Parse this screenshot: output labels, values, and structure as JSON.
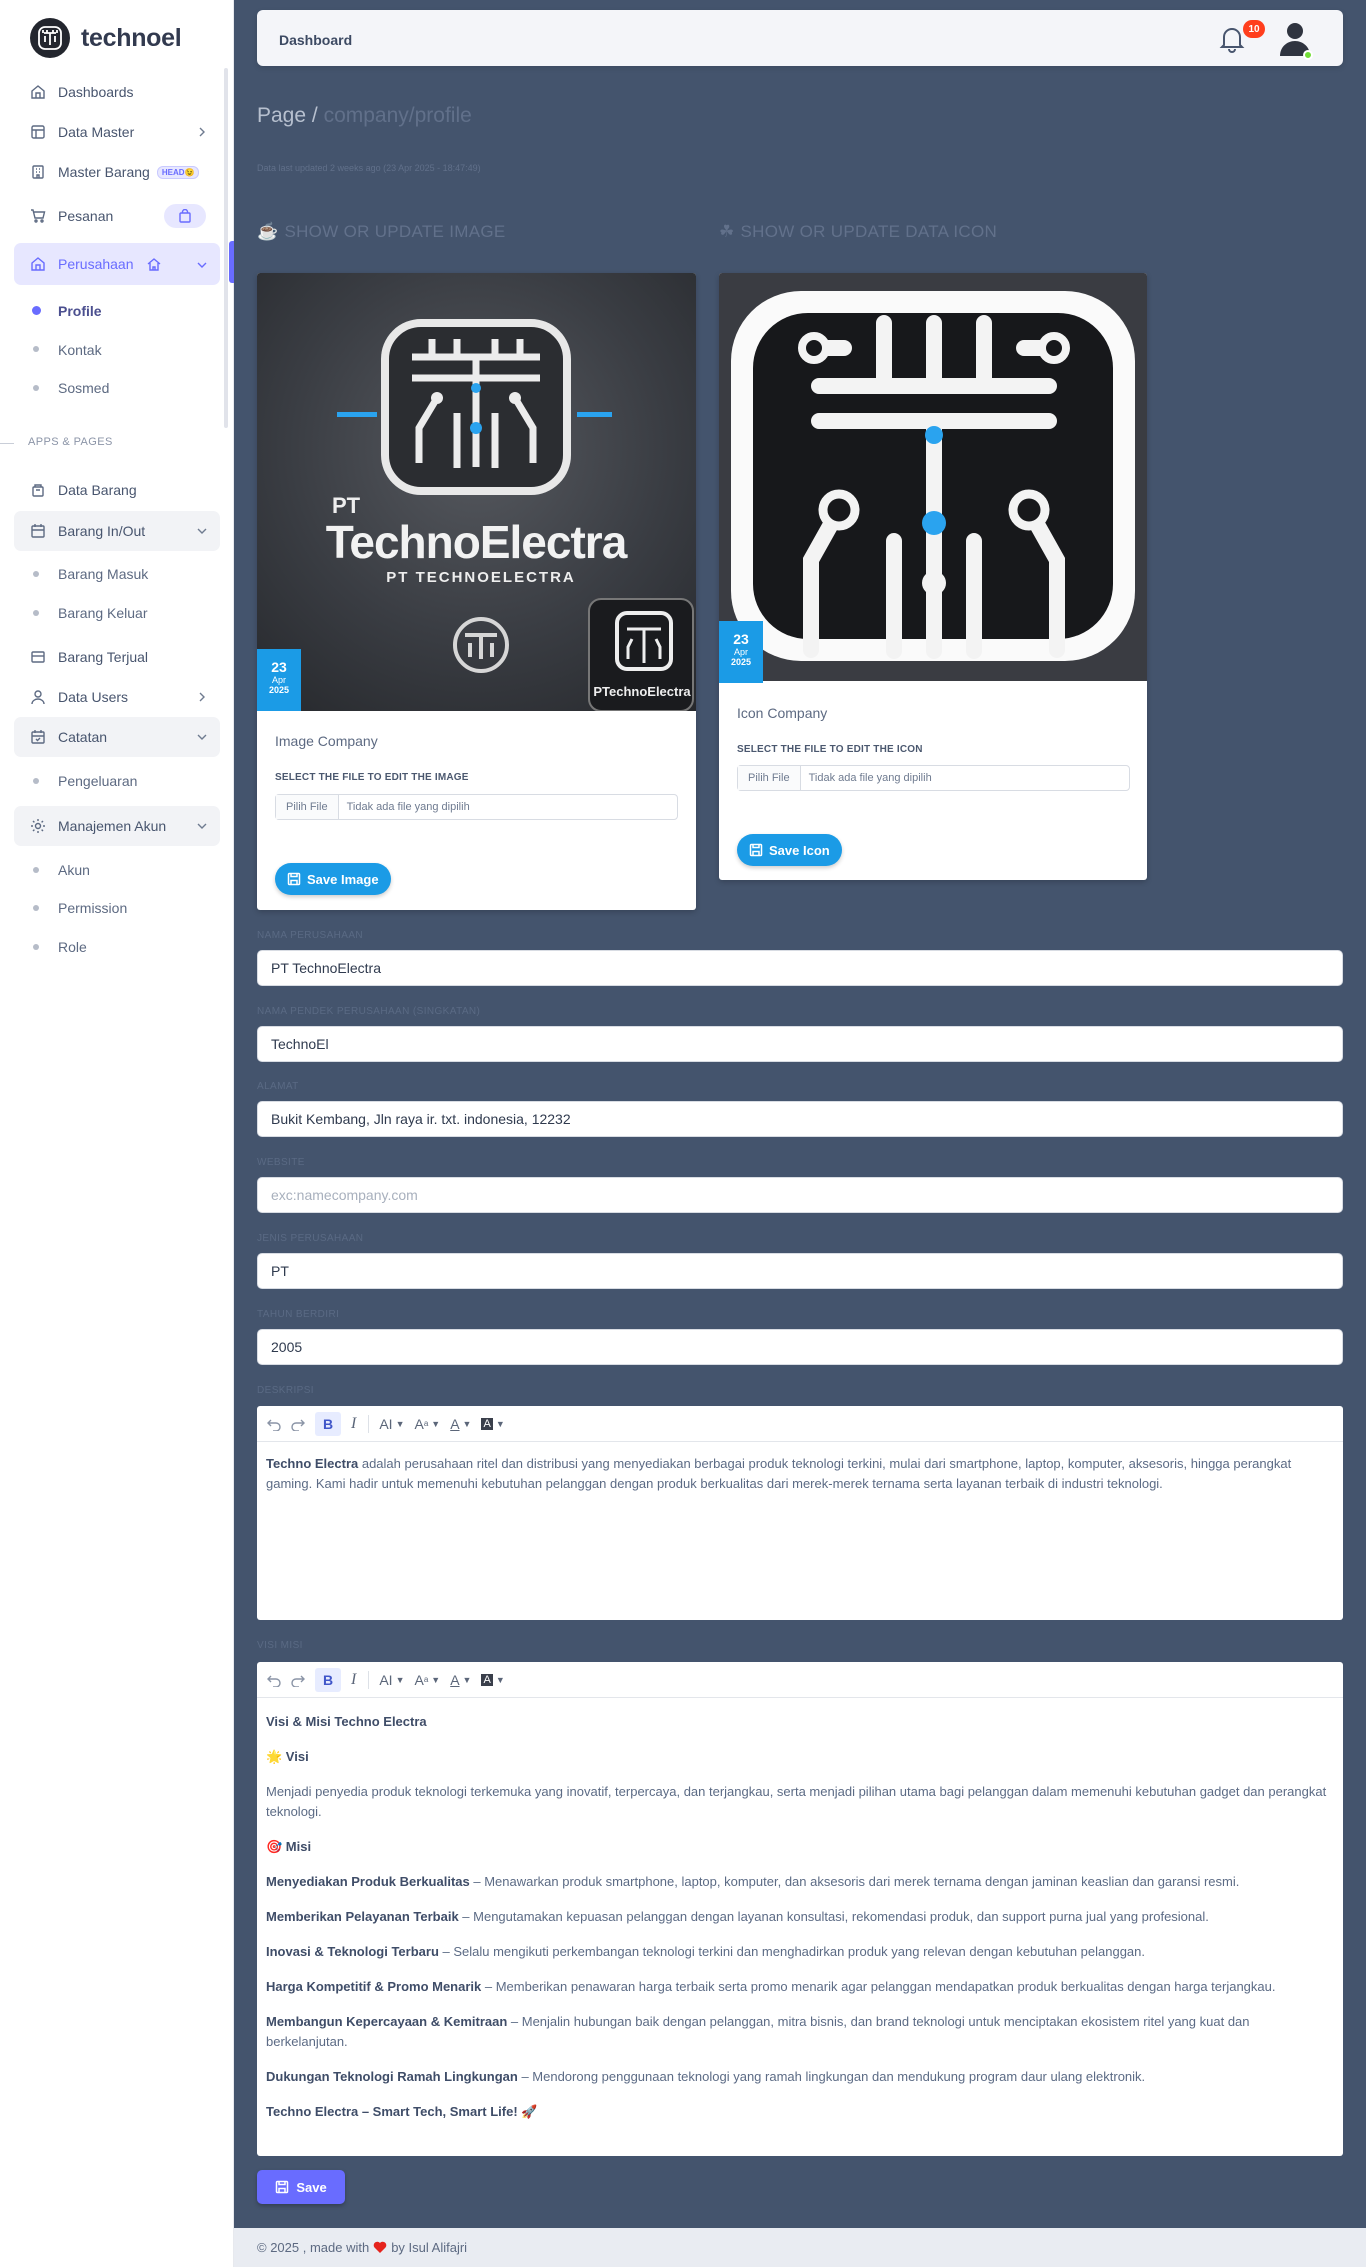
{
  "brand": {
    "name": "technoel"
  },
  "sidebar": {
    "items": [
      {
        "label": "Dashboards"
      },
      {
        "label": "Data Master"
      },
      {
        "label": "Master Barang",
        "badge": "HEAD😉"
      },
      {
        "label": "Pesanan"
      },
      {
        "label": "Perusahaan"
      }
    ],
    "perusahaan_sub": [
      "Profile",
      "Kontak",
      "Sosmed"
    ],
    "section_header": "APPS & PAGES",
    "apps": [
      {
        "label": "Data Barang"
      },
      {
        "label": "Barang In/Out"
      }
    ],
    "barang_sub": [
      "Barang Masuk",
      "Barang Keluar"
    ],
    "apps2": [
      {
        "label": "Barang Terjual"
      },
      {
        "label": "Data Users"
      },
      {
        "label": "Catatan"
      }
    ],
    "catatan_sub": [
      "Pengeluaran"
    ],
    "akun": {
      "label": "Manajemen Akun"
    },
    "akun_sub": [
      "Akun",
      "Permission",
      "Role"
    ]
  },
  "navbar": {
    "title": "Dashboard",
    "notifications": "10"
  },
  "page": {
    "breadcrumb_root": "Page /",
    "breadcrumb_current": "company/profile",
    "updated": "Data last updated 2 weeks ago (23 Apr 2025 - 18:47:49)"
  },
  "image_card": {
    "title": "SHOW OR UPDATE IMAGE",
    "title_emoji": "☕",
    "logo_pt": "PT",
    "logo_name": "TechnoElectra",
    "logo_sub": "PT TECHNOELECTRA",
    "phone_text": "PTechnoElectra",
    "date_day": "23",
    "date_month": "Apr",
    "date_year": "2025",
    "caption": "Image Company",
    "select_label": "SELECT THE FILE TO EDIT THE IMAGE",
    "file_button": "Pilih File",
    "file_name": "Tidak ada file yang dipilih",
    "save_label": "Save Image"
  },
  "icon_card": {
    "title": "SHOW OR UPDATE DATA ICON",
    "title_emoji": "☘",
    "date_day": "23",
    "date_month": "Apr",
    "date_year": "2025",
    "caption": "Icon Company",
    "select_label": "SELECT THE FILE TO EDIT THE ICON",
    "file_button": "Pilih File",
    "file_name": "Tidak ada file yang dipilih",
    "save_label": "Save Icon"
  },
  "form": {
    "nama_label": "NAMA PERUSAHAAN",
    "nama_value": "PT TechnoElectra",
    "singkat_label": "NAMA PENDEK PERUSAHAAN (SINGKATAN)",
    "singkat_value": "TechnoEl",
    "alamat_label": "ALAMAT",
    "alamat_value": "Bukit Kembang, Jln raya ir. txt. indonesia, 12232",
    "website_label": "WEBSITE",
    "website_placeholder": "exc:namecompany.com",
    "jenis_label": "JENIS PERUSAHAAN",
    "jenis_value": "PT",
    "tahun_label": "TAHUN BERDIRI",
    "tahun_value": "2005",
    "deskripsi_label": "DESKRIPSI",
    "deskripsi_bold": "Techno Electra",
    "deskripsi_text": " adalah perusahaan ritel dan distribusi yang menyediakan berbagai produk teknologi terkini, mulai dari smartphone, laptop, komputer, aksesoris, hingga perangkat gaming. Kami hadir untuk memenuhi kebutuhan pelanggan dengan produk berkualitas dari merek-merek ternama serta layanan terbaik di industri teknologi.",
    "visimisi_label": "VISI MISI",
    "save_label": "Save"
  },
  "toolbar": {
    "ai": "AI",
    "a_sup": "A",
    "a_color": "A",
    "a_bg": "A"
  },
  "visimisi": {
    "heading": "Visi & Misi Techno Electra",
    "visi_title": "🌟 Visi",
    "visi_text": "Menjadi penyedia produk teknologi terkemuka yang inovatif, terpercaya, dan terjangkau, serta menjadi pilihan utama bagi pelanggan dalam memenuhi kebutuhan gadget dan perangkat teknologi.",
    "misi_title": "🎯 Misi",
    "misi": [
      {
        "b": "Menyediakan Produk Berkualitas",
        "t": " – Menawarkan produk smartphone, laptop, komputer, dan aksesoris dari merek ternama dengan jaminan keaslian dan garansi resmi."
      },
      {
        "b": "Memberikan Pelayanan Terbaik",
        "t": " – Mengutamakan kepuasan pelanggan dengan layanan konsultasi, rekomendasi produk, dan support purna jual yang profesional."
      },
      {
        "b": "Inovasi & Teknologi Terbaru",
        "t": " – Selalu mengikuti perkembangan teknologi terkini dan menghadirkan produk yang relevan dengan kebutuhan pelanggan."
      },
      {
        "b": "Harga Kompetitif & Promo Menarik",
        "t": " – Memberikan penawaran harga terbaik serta promo menarik agar pelanggan mendapatkan produk berkualitas dengan harga terjangkau."
      },
      {
        "b": "Membangun Kepercayaan & Kemitraan",
        "t": " – Menjalin hubungan baik dengan pelanggan, mitra bisnis, dan brand teknologi untuk menciptakan ekosistem ritel yang kuat dan berkelanjutan."
      },
      {
        "b": "Dukungan Teknologi Ramah Lingkungan",
        "t": " – Mendorong penggunaan teknologi yang ramah lingkungan dan mendukung program daur ulang elektronik."
      }
    ],
    "tagline": "Techno Electra – Smart Tech, Smart Life! 🚀"
  },
  "footer": {
    "prefix": "© 2025 , made with",
    "suffix": "by Isul Alifajri"
  },
  "colors": {
    "primary": "#696cff",
    "info": "#1b9be6",
    "main_bg": "#44546d",
    "danger": "#ff3e1d"
  }
}
